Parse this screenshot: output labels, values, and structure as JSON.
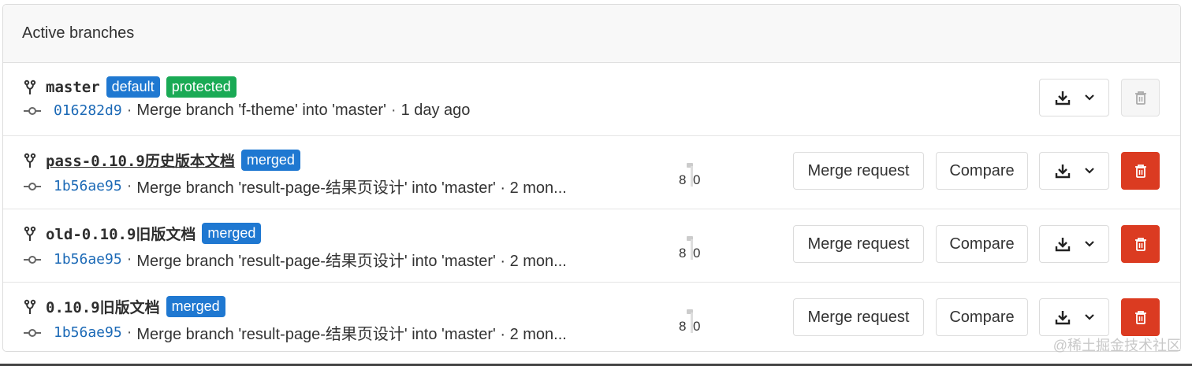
{
  "panel": {
    "title": "Active branches"
  },
  "colors": {
    "default_badge": "#1f78d1",
    "protected_badge": "#1aaa55",
    "merged_badge": "#1f78d1",
    "delete_button": "#db3b21",
    "sha": "#1b69b6"
  },
  "branches": [
    {
      "name": "master",
      "badges": [
        "default",
        "protected"
      ],
      "sha": "016282d9",
      "commit_title": "Merge branch 'f-theme' into 'master'",
      "time": "1 day ago"
    },
    {
      "name": "pass-0.10.9历史版本文档",
      "badges": [
        "merged"
      ],
      "sha": "1b56ae95",
      "commit_title": "Merge branch 'result-page-结果页设计' into 'master' · 2 mon...",
      "behind": "8",
      "ahead": "0"
    },
    {
      "name": "old-0.10.9旧版文档",
      "badges": [
        "merged"
      ],
      "sha": "1b56ae95",
      "commit_title": "Merge branch 'result-page-结果页设计' into 'master' · 2 mon...",
      "behind": "8",
      "ahead": "0"
    },
    {
      "name": "0.10.9旧版文档",
      "badges": [
        "merged"
      ],
      "sha": "1b56ae95",
      "commit_title": "Merge branch 'result-page-结果页设计' into 'master' · 2 mon...",
      "behind": "8",
      "ahead": "0"
    }
  ],
  "buttons": {
    "merge_request": "Merge request",
    "compare": "Compare"
  },
  "watermark": "@稀土掘金技术社区"
}
